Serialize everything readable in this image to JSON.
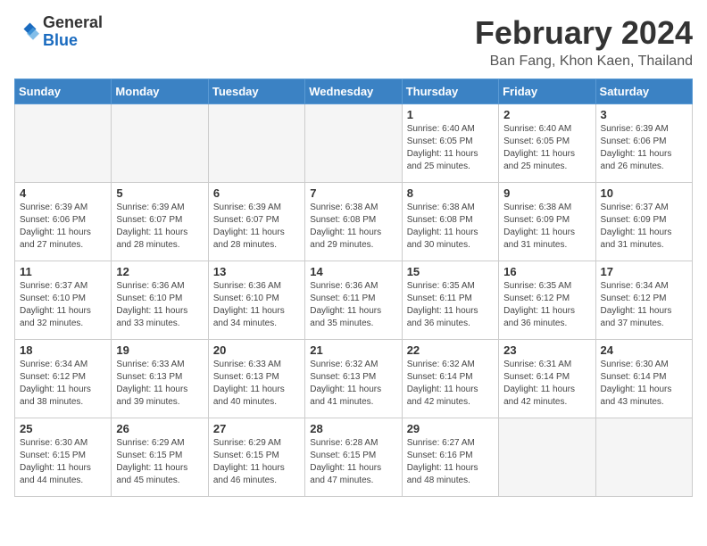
{
  "header": {
    "logo": {
      "line1": "General",
      "line2": "Blue"
    },
    "title": "February 2024",
    "subtitle": "Ban Fang, Khon Kaen, Thailand"
  },
  "weekdays": [
    "Sunday",
    "Monday",
    "Tuesday",
    "Wednesday",
    "Thursday",
    "Friday",
    "Saturday"
  ],
  "weeks": [
    [
      {
        "day": "",
        "info": ""
      },
      {
        "day": "",
        "info": ""
      },
      {
        "day": "",
        "info": ""
      },
      {
        "day": "",
        "info": ""
      },
      {
        "day": "1",
        "info": "Sunrise: 6:40 AM\nSunset: 6:05 PM\nDaylight: 11 hours\nand 25 minutes."
      },
      {
        "day": "2",
        "info": "Sunrise: 6:40 AM\nSunset: 6:05 PM\nDaylight: 11 hours\nand 25 minutes."
      },
      {
        "day": "3",
        "info": "Sunrise: 6:39 AM\nSunset: 6:06 PM\nDaylight: 11 hours\nand 26 minutes."
      }
    ],
    [
      {
        "day": "4",
        "info": "Sunrise: 6:39 AM\nSunset: 6:06 PM\nDaylight: 11 hours\nand 27 minutes."
      },
      {
        "day": "5",
        "info": "Sunrise: 6:39 AM\nSunset: 6:07 PM\nDaylight: 11 hours\nand 28 minutes."
      },
      {
        "day": "6",
        "info": "Sunrise: 6:39 AM\nSunset: 6:07 PM\nDaylight: 11 hours\nand 28 minutes."
      },
      {
        "day": "7",
        "info": "Sunrise: 6:38 AM\nSunset: 6:08 PM\nDaylight: 11 hours\nand 29 minutes."
      },
      {
        "day": "8",
        "info": "Sunrise: 6:38 AM\nSunset: 6:08 PM\nDaylight: 11 hours\nand 30 minutes."
      },
      {
        "day": "9",
        "info": "Sunrise: 6:38 AM\nSunset: 6:09 PM\nDaylight: 11 hours\nand 31 minutes."
      },
      {
        "day": "10",
        "info": "Sunrise: 6:37 AM\nSunset: 6:09 PM\nDaylight: 11 hours\nand 31 minutes."
      }
    ],
    [
      {
        "day": "11",
        "info": "Sunrise: 6:37 AM\nSunset: 6:10 PM\nDaylight: 11 hours\nand 32 minutes."
      },
      {
        "day": "12",
        "info": "Sunrise: 6:36 AM\nSunset: 6:10 PM\nDaylight: 11 hours\nand 33 minutes."
      },
      {
        "day": "13",
        "info": "Sunrise: 6:36 AM\nSunset: 6:10 PM\nDaylight: 11 hours\nand 34 minutes."
      },
      {
        "day": "14",
        "info": "Sunrise: 6:36 AM\nSunset: 6:11 PM\nDaylight: 11 hours\nand 35 minutes."
      },
      {
        "day": "15",
        "info": "Sunrise: 6:35 AM\nSunset: 6:11 PM\nDaylight: 11 hours\nand 36 minutes."
      },
      {
        "day": "16",
        "info": "Sunrise: 6:35 AM\nSunset: 6:12 PM\nDaylight: 11 hours\nand 36 minutes."
      },
      {
        "day": "17",
        "info": "Sunrise: 6:34 AM\nSunset: 6:12 PM\nDaylight: 11 hours\nand 37 minutes."
      }
    ],
    [
      {
        "day": "18",
        "info": "Sunrise: 6:34 AM\nSunset: 6:12 PM\nDaylight: 11 hours\nand 38 minutes."
      },
      {
        "day": "19",
        "info": "Sunrise: 6:33 AM\nSunset: 6:13 PM\nDaylight: 11 hours\nand 39 minutes."
      },
      {
        "day": "20",
        "info": "Sunrise: 6:33 AM\nSunset: 6:13 PM\nDaylight: 11 hours\nand 40 minutes."
      },
      {
        "day": "21",
        "info": "Sunrise: 6:32 AM\nSunset: 6:13 PM\nDaylight: 11 hours\nand 41 minutes."
      },
      {
        "day": "22",
        "info": "Sunrise: 6:32 AM\nSunset: 6:14 PM\nDaylight: 11 hours\nand 42 minutes."
      },
      {
        "day": "23",
        "info": "Sunrise: 6:31 AM\nSunset: 6:14 PM\nDaylight: 11 hours\nand 42 minutes."
      },
      {
        "day": "24",
        "info": "Sunrise: 6:30 AM\nSunset: 6:14 PM\nDaylight: 11 hours\nand 43 minutes."
      }
    ],
    [
      {
        "day": "25",
        "info": "Sunrise: 6:30 AM\nSunset: 6:15 PM\nDaylight: 11 hours\nand 44 minutes."
      },
      {
        "day": "26",
        "info": "Sunrise: 6:29 AM\nSunset: 6:15 PM\nDaylight: 11 hours\nand 45 minutes."
      },
      {
        "day": "27",
        "info": "Sunrise: 6:29 AM\nSunset: 6:15 PM\nDaylight: 11 hours\nand 46 minutes."
      },
      {
        "day": "28",
        "info": "Sunrise: 6:28 AM\nSunset: 6:15 PM\nDaylight: 11 hours\nand 47 minutes."
      },
      {
        "day": "29",
        "info": "Sunrise: 6:27 AM\nSunset: 6:16 PM\nDaylight: 11 hours\nand 48 minutes."
      },
      {
        "day": "",
        "info": ""
      },
      {
        "day": "",
        "info": ""
      }
    ]
  ]
}
